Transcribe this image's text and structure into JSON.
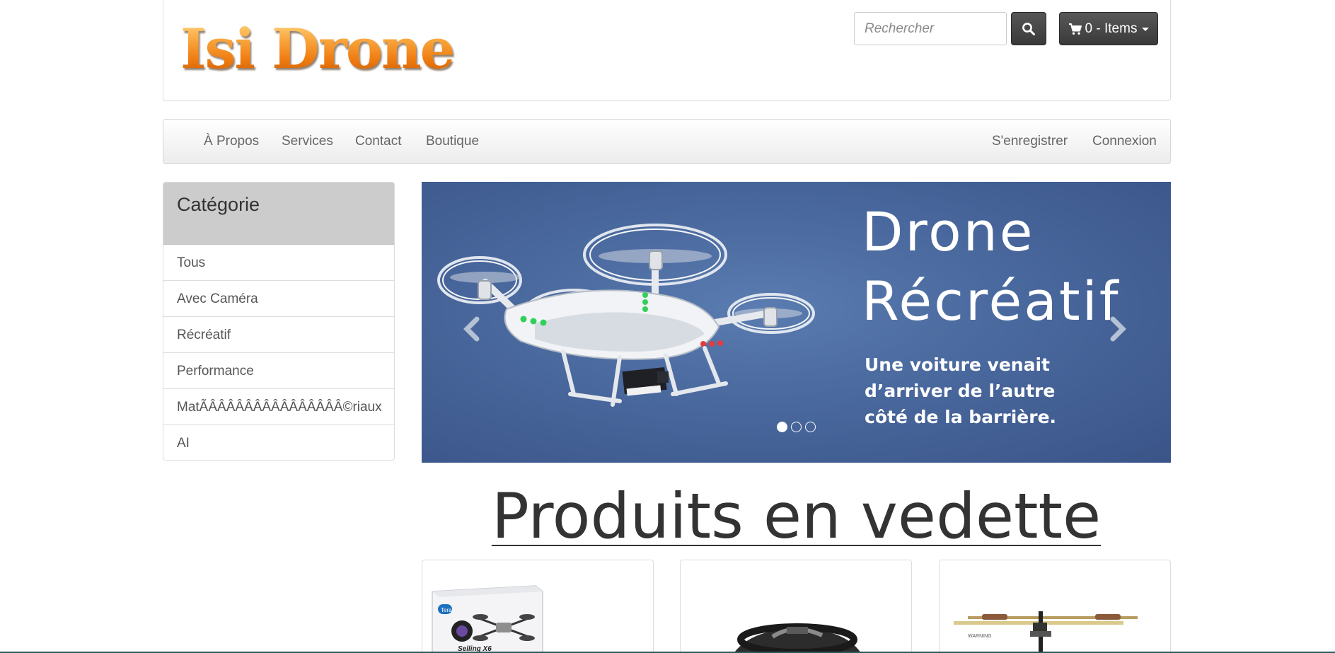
{
  "brand": {
    "logo_text": "Isi Drone"
  },
  "search": {
    "placeholder": "Rechercher"
  },
  "cart": {
    "label": "0 - Items"
  },
  "nav": {
    "left": [
      "À Propos",
      "Services",
      "Contact",
      "Boutique"
    ],
    "right": [
      "S'enregistrer",
      "Connexion"
    ]
  },
  "sidebar": {
    "heading": "Catégorie",
    "items": [
      "Tous",
      "Avec Caméra",
      "Récréatif",
      "Performance",
      "MatÃÂÂÂÂÂÂÂÂÂÂÂÂÂÂÂ©riaux",
      "AI"
    ]
  },
  "carousel": {
    "slide_title_line1": "Drone",
    "slide_title_line2": "Récréatif",
    "slide_caption_line1": "Une voiture venait",
    "slide_caption_line2": "d’arriver de l’autre",
    "slide_caption_line3": "côté de la barrière.",
    "slide_count": 3,
    "active_slide": 1,
    "background_color": "#49689d"
  },
  "featured": {
    "title": "Produits en vedette",
    "products": [
      {
        "image_icon": "quadcopter-box-image",
        "box_brand": "Tera",
        "box_text": "Selling X6"
      },
      {
        "image_icon": "ar-drone-image"
      },
      {
        "image_icon": "helicopter-image",
        "box_text": "WARNING"
      }
    ]
  },
  "colors": {
    "logo_orange": "#f5891e",
    "button_dark": "#444444",
    "sidebar_heading_bg": "#cccccc"
  }
}
